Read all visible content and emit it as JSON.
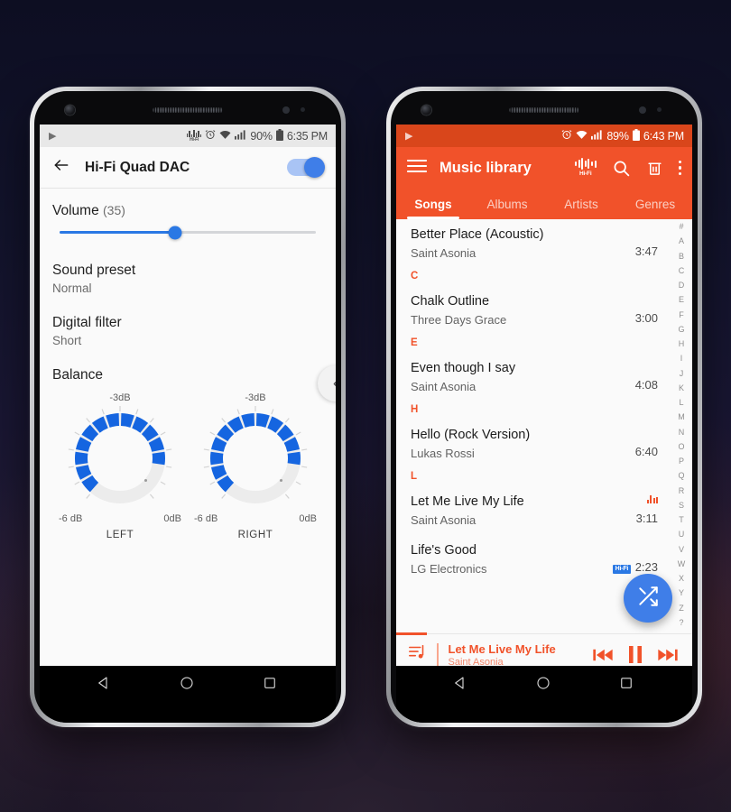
{
  "theme": {
    "orange": "#f1522a",
    "orange_status": "#d9461b",
    "blue": "#2a78e4",
    "fab_blue": "#3f7ee8",
    "screen_bg": "#fafafa"
  },
  "left_phone": {
    "status_bar": {
      "play_icon": "play-icon",
      "hifi_icon": "hifi-icon",
      "alarm_icon": "alarm-clock-icon",
      "wifi_icon": "wifi-icon",
      "signal_icon": "signal-bars-icon",
      "battery_percent": "90%",
      "battery_icon": "battery-icon",
      "time": "6:35 PM"
    },
    "appbar": {
      "back_icon": "back-arrow-icon",
      "title": "Hi-Fi Quad DAC",
      "toggle_on": true
    },
    "volume": {
      "label": "Volume",
      "value_text": "(35)",
      "value": 35,
      "percent": 45
    },
    "sound_preset": {
      "label": "Sound preset",
      "value": "Normal"
    },
    "digital_filter": {
      "label": "Digital filter",
      "value": "Short"
    },
    "balance": {
      "label": "Balance",
      "channels": [
        {
          "name": "LEFT",
          "top_label": "-3dB",
          "min_label": "-6 dB",
          "max_label": "0dB",
          "filled_segments": 12,
          "total_segments": 14
        },
        {
          "name": "RIGHT",
          "top_label": "-3dB",
          "min_label": "-6 dB",
          "max_label": "0dB",
          "filled_segments": 12,
          "total_segments": 14
        }
      ]
    },
    "side_handle_icon": "chevron-left-icon",
    "nav_bar": {
      "back": "nav-back-icon",
      "home": "nav-home-icon",
      "recents": "nav-recents-icon"
    }
  },
  "right_phone": {
    "status_bar": {
      "play_icon": "play-icon",
      "alarm_icon": "alarm-clock-icon",
      "wifi_icon": "wifi-icon",
      "signal_icon": "signal-bars-icon",
      "battery_percent": "89%",
      "battery_icon": "battery-icon",
      "time": "6:43 PM"
    },
    "appbar": {
      "menu_icon": "hamburger-menu-icon",
      "title": "Music library",
      "actions": [
        {
          "name": "hifi-button",
          "label": "Hi-Fi"
        },
        {
          "name": "search-icon",
          "label": ""
        },
        {
          "name": "trash-icon",
          "label": ""
        },
        {
          "name": "overflow-menu-icon",
          "label": ""
        }
      ]
    },
    "tabs": [
      {
        "label": "Songs",
        "active": true
      },
      {
        "label": "Albums",
        "active": false
      },
      {
        "label": "Artists",
        "active": false
      },
      {
        "label": "Genres",
        "active": false
      }
    ],
    "songs": [
      {
        "type": "song",
        "title": "Better Place (Acoustic)",
        "artist": "Saint Asonia",
        "duration": "3:47",
        "playing": false,
        "hifi": false
      },
      {
        "type": "section",
        "letter": "C"
      },
      {
        "type": "song",
        "title": "Chalk Outline",
        "artist": "Three Days Grace",
        "duration": "3:00",
        "playing": false,
        "hifi": false
      },
      {
        "type": "section",
        "letter": "E"
      },
      {
        "type": "song",
        "title": "Even though I say",
        "artist": "Saint Asonia",
        "duration": "4:08",
        "playing": false,
        "hifi": false
      },
      {
        "type": "section",
        "letter": "H"
      },
      {
        "type": "song",
        "title": "Hello (Rock Version)",
        "artist": "Lukas Rossi",
        "duration": "6:40",
        "playing": false,
        "hifi": false
      },
      {
        "type": "section",
        "letter": "L"
      },
      {
        "type": "song",
        "title": "Let Me Live My Life",
        "artist": "Saint Asonia",
        "duration": "3:11",
        "playing": true,
        "hifi": false
      },
      {
        "type": "song",
        "title": "Life's Good",
        "artist": "LG Electronics",
        "duration": "2:23",
        "playing": false,
        "hifi": true,
        "hifi_badge": "Hi-Fi"
      }
    ],
    "az_index": [
      "#",
      "A",
      "B",
      "C",
      "D",
      "E",
      "F",
      "G",
      "H",
      "I",
      "J",
      "K",
      "L",
      "M",
      "N",
      "O",
      "P",
      "Q",
      "R",
      "S",
      "T",
      "U",
      "V",
      "W",
      "X",
      "Y",
      "Z",
      "?"
    ],
    "fab": {
      "icon": "shuffle-icon"
    },
    "mini_player": {
      "queue_icon": "playlist-queue-icon",
      "title": "Let Me Live My Life",
      "artist": "Saint Asonia",
      "prev_icon": "previous-track-icon",
      "pause_icon": "pause-icon",
      "next_icon": "next-track-icon"
    },
    "nav_bar": {
      "back": "nav-back-icon",
      "home": "nav-home-icon",
      "recents": "nav-recents-icon"
    }
  }
}
